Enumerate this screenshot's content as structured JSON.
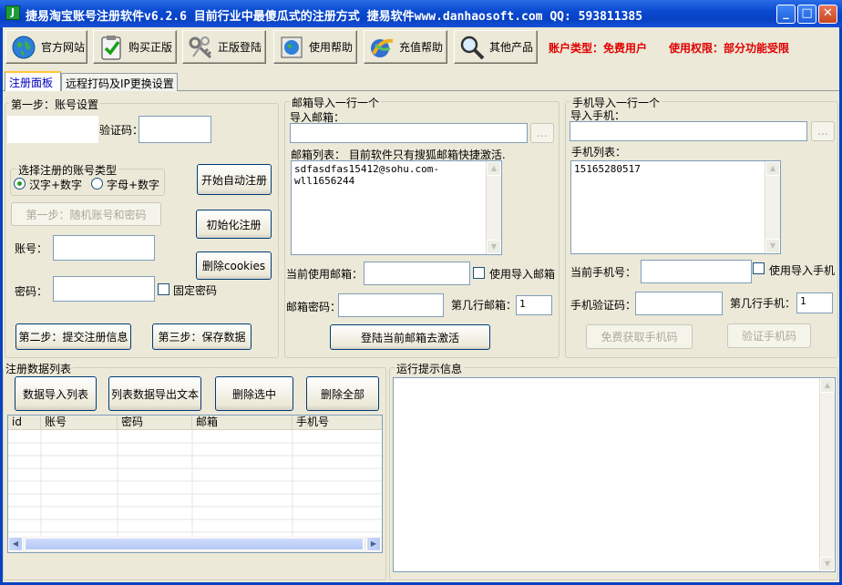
{
  "window": {
    "title": "捷易淘宝账号注册软件v6.2.6 目前行业中最傻瓜式的注册方式 捷易软件www.danhaosoft.com QQ: 593811385",
    "app_icon": "J",
    "min": "_",
    "max": "□",
    "close": "✕"
  },
  "toolbar": {
    "items": [
      {
        "label": "官方网站",
        "icon": "globe-icon"
      },
      {
        "label": "购买正版",
        "icon": "clipboard-check-icon"
      },
      {
        "label": "正版登陆",
        "icon": "keys-icon"
      },
      {
        "label": "使用帮助",
        "icon": "help-globe-icon"
      },
      {
        "label": "充值帮助",
        "icon": "recharge-icon"
      },
      {
        "label": "其他产品",
        "icon": "magnifier-icon"
      }
    ],
    "account_type": "账户类型：免费用户",
    "permission": "使用权限：部分功能受限"
  },
  "tabs": [
    {
      "label": "注册面板"
    },
    {
      "label": "远程打码及IP更换设置"
    }
  ],
  "step1": {
    "group_title": "第一步：账号设置",
    "captcha_label": "验证码：",
    "type_group_title": "选择注册的账号类型",
    "radio_hanzi": "汉字+数字",
    "radio_letter": "字母+数字",
    "random_button": "第一步：随机账号和密码",
    "account_label": "账号：",
    "password_label": "密码：",
    "fixed_password": "固定密码",
    "auto_register": "开始自动注册",
    "init_register": "初始化注册",
    "delete_cookies": "删除cookies",
    "submit_button": "第二步：提交注册信息",
    "save_button": "第三步：保存数据"
  },
  "email": {
    "group_title": "邮箱导入一行一个",
    "import_label": "导入邮箱：",
    "browse": "...",
    "list_label": "邮箱列表： 目前软件只有搜狐邮箱快捷激活.",
    "list_content": "sdfasdfas15412@sohu.com-wll1656244",
    "current_label": "当前使用邮箱：",
    "use_import": "使用导入邮箱",
    "password_label": "邮箱密码：",
    "row_label": "第几行邮箱：",
    "row_value": "1",
    "activate_button": "登陆当前邮箱去激活"
  },
  "phone": {
    "group_title": "手机导入一行一个",
    "import_label": "导入手机：",
    "browse": "...",
    "list_label": "手机列表：",
    "list_content": "15165280517",
    "current_label": "当前手机号：",
    "use_import": "使用导入手机",
    "code_label": "手机验证码：",
    "row_label": "第几行手机：",
    "row_value": "1",
    "get_code": "免费获取手机码",
    "verify_code": "验证手机码"
  },
  "datalist": {
    "group_title": "注册数据列表",
    "import_button": "数据导入列表",
    "export_button": "列表数据导出文本",
    "delete_selected": "删除选中",
    "delete_all": "删除全部",
    "columns": [
      "id",
      "账号",
      "密码",
      "邮箱",
      "手机号"
    ]
  },
  "log": {
    "group_title": "运行提示信息"
  }
}
